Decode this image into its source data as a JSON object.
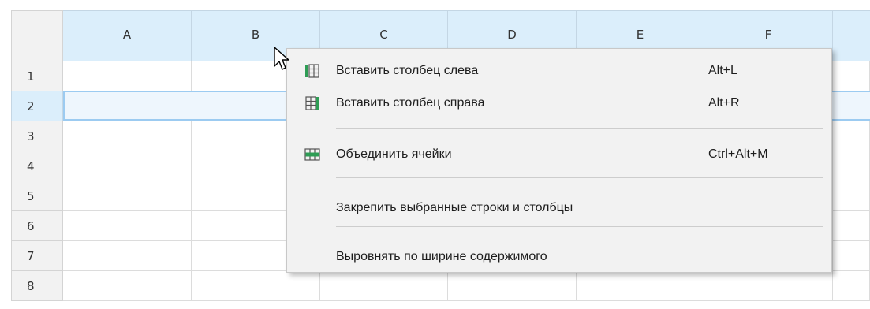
{
  "columns": [
    "A",
    "B",
    "C",
    "D",
    "E",
    "F"
  ],
  "rows": [
    "1",
    "2",
    "3",
    "4",
    "5",
    "6",
    "7",
    "8"
  ],
  "selected_row": "2",
  "context_menu": {
    "items": [
      {
        "label": "Вставить столбец слева",
        "shortcut": "Alt+L",
        "icon": "insert-column-left-icon"
      },
      {
        "label": "Вставить столбец справа",
        "shortcut": "Alt+R",
        "icon": "insert-column-right-icon"
      },
      {
        "label": "Объединить ячейки",
        "shortcut": "Ctrl+Alt+M",
        "icon": "merge-cells-icon"
      },
      {
        "label": "Закрепить выбранные строки и столбцы",
        "shortcut": "",
        "icon": ""
      },
      {
        "label": "Выровнять по ширине содержимого",
        "shortcut": "",
        "icon": ""
      }
    ]
  },
  "colors": {
    "header_selected": "#dbeefb",
    "row_selection_border": "#9ccbf1",
    "icon_green": "#2e9d55"
  }
}
